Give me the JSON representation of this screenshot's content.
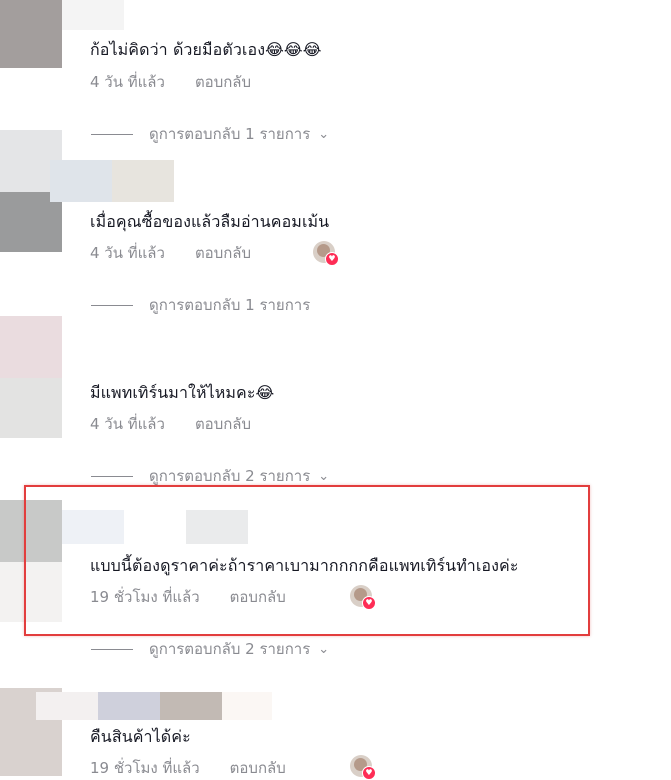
{
  "comments": [
    {
      "text": "ก้อไม่คิดว่า ด้วยมือตัวเอง😂😂😂",
      "time": "4 วัน ที่แล้ว",
      "reply": "ตอบกลับ",
      "view_replies": "ดูการตอบกลับ 1 รายการ"
    },
    {
      "text": "เมื่อคุณซื้อของแล้วลืมอ่านคอมเม้น",
      "time": "4 วัน ที่แล้ว",
      "reply": "ตอบกลับ",
      "view_replies": "ดูการตอบกลับ 1 รายการ"
    },
    {
      "text": "มีแพทเทิร์นมาให้ไหมคะ😂",
      "time": "4 วัน ที่แล้ว",
      "reply": "ตอบกลับ",
      "view_replies": "ดูการตอบกลับ 2 รายการ"
    },
    {
      "text": "แบบนี้ต้องดูราคาค่ะถ้าราคาเบามากกกกคือแพทเทิร์นทำเองค่ะ",
      "time": "19 ชั่วโมง ที่แล้ว",
      "reply": "ตอบกลับ",
      "view_replies": "ดูการตอบกลับ 2 รายการ"
    },
    {
      "text": "คืนสินค้าได้ค่ะ",
      "time": "19 ชั่วโมง ที่แล้ว",
      "reply": "ตอบกลับ"
    }
  ],
  "icons": {
    "chevron": "chevron-down-icon",
    "heart": "heart-icon",
    "creator_like": "creator-liked-avatar-icon"
  },
  "colors": {
    "text": "#161823",
    "meta": "#8a8b91",
    "highlight": "#e23d3d",
    "heart": "#fe2c55"
  }
}
